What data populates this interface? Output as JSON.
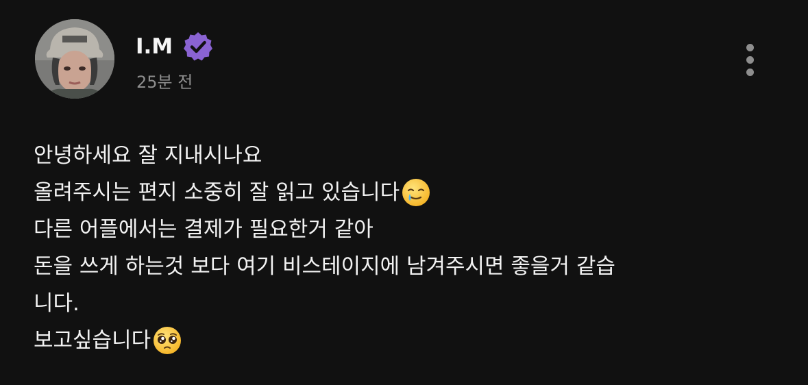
{
  "post": {
    "author": {
      "name": "I.M",
      "verified": true,
      "badge_color": "#8a63d2"
    },
    "timestamp": "25분 전",
    "body_lines": [
      "안녕하세요 잘 지내시나요",
      "올려주시는 편지 소중히 잘 읽고 있습니다",
      "다른 어플에서는 결제가 필요한거 같아",
      "돈을 쓰게 하는것 보다 여기 비스테이지에 남겨주시면 좋을거 같습",
      "니다.",
      "보고싶습니다"
    ],
    "emojis": {
      "line_2": "smiling-face-with-tear-icon",
      "line_6": "pleading-face-icon"
    }
  },
  "colors": {
    "background": "#111111",
    "text": "#f2f2f2",
    "muted": "#8e8e8e",
    "verified": "#8a63d2"
  }
}
